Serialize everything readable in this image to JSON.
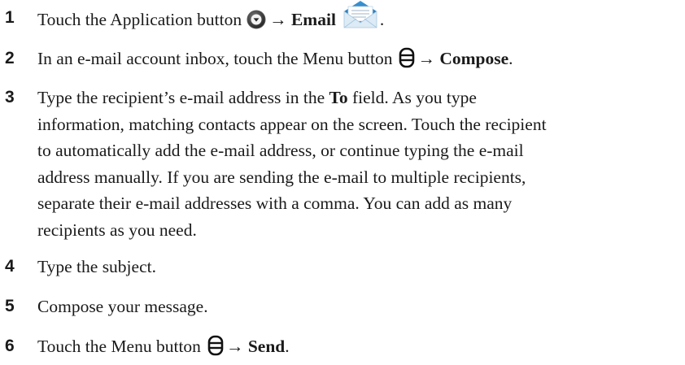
{
  "steps": [
    {
      "number": "1",
      "text_before": "Touch the Application button",
      "arrow": "→",
      "bold": "Email",
      "text_after": ".",
      "icons": [
        "application-button-icon",
        "email-app-icon"
      ]
    },
    {
      "number": "2",
      "text_before": "In an e-mail account inbox, touch the Menu button",
      "arrow": "→",
      "bold": "Compose",
      "text_after": ".",
      "icons": [
        "menu-button-icon"
      ]
    },
    {
      "number": "3",
      "lines": [
        {
          "before": "Type the recipient’s e-mail address in the ",
          "bold": "To",
          "after": " field. As you type"
        },
        {
          "text": "information, matching contacts appear on the screen. Touch the recipient"
        },
        {
          "text": "to automatically add the e-mail address, or continue typing the e-mail"
        },
        {
          "text": "address manually. If you are sending the e-mail to multiple recipients,"
        },
        {
          "text": "separate their e-mail addresses with a comma. You can add as many"
        },
        {
          "text": "recipients as you need."
        }
      ]
    },
    {
      "number": "4",
      "text": "Type the subject."
    },
    {
      "number": "5",
      "text": "Compose your message."
    },
    {
      "number": "6",
      "text_before": "Touch the Menu button",
      "arrow": "→",
      "bold": "Send",
      "text_after": ".",
      "icons": [
        "menu-button-icon"
      ]
    }
  ],
  "colors": {
    "text": "#1a1a1a",
    "envelope_blue": "#1f73b8",
    "envelope_light": "#dcebf5"
  }
}
